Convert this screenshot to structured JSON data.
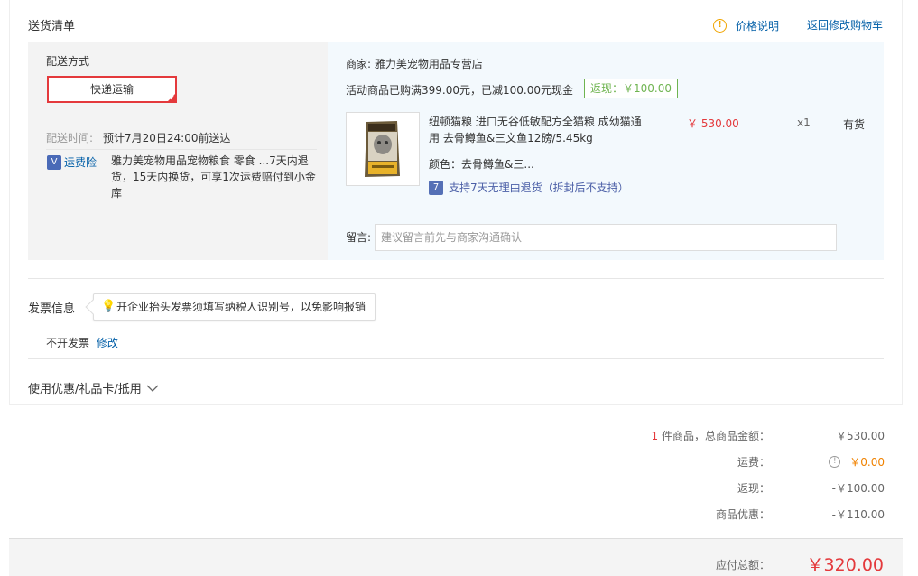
{
  "header": {
    "title": "送货清单",
    "price_note": "价格说明",
    "back_to_cart": "返回修改购物车"
  },
  "shipping": {
    "label": "配送方式",
    "method": "快递运输",
    "time_label": "配送时间:",
    "time_value": "预计7月20日24:00前送达",
    "insurance_badge": "V",
    "insurance_label": "运费险",
    "insurance_desc_1": "雅力美宠物用品宠物粮食 零食 ...7天内退",
    "insurance_desc_2": "货，15天内换货，可享1次运费赔付到小金",
    "insurance_desc_3": "库"
  },
  "shop": {
    "seller_label": "商家:",
    "seller_name": "雅力美宠物用品专营店",
    "promo_text": "活动商品已购满399.00元，已减100.00元现金",
    "cashback": "返现：￥100.00"
  },
  "item": {
    "name_line1": "纽顿猫粮 进口无谷低敏配方全猫粮 成幼猫通",
    "name_line2": "用 去骨鳟鱼&三文鱼12磅/5.45kg",
    "price": "￥ 530.00",
    "qty": "x1",
    "stock": "有货",
    "color_label": "颜色：",
    "color_value": "去骨鳟鱼&三...",
    "return_badge": "7",
    "return_policy": "支持7天无理由退货（拆封后不支持）"
  },
  "message": {
    "label": "留言:",
    "placeholder": "建议留言前先与商家沟通确认"
  },
  "invoice": {
    "title": "发票信息",
    "tip": "开企业抬头发票须填写纳税人识别号，以免影响报销",
    "status": "不开发票",
    "modify": "修改"
  },
  "coupon": {
    "label": "使用优惠/礼品卡/抵用"
  },
  "summary": {
    "count": "1",
    "count_suffix": "件商品，总商品金额：",
    "goods_amount": "￥530.00",
    "freight_label": "运费：",
    "freight_value": "￥0.00",
    "cashback_label": "返现：",
    "cashback_value": "-￥100.00",
    "discount_label": "商品优惠：",
    "discount_value": "-￥110.00",
    "total_label": "应付总额：",
    "total_value": "￥320.00"
  },
  "colors": {
    "accent_red": "#e4393c",
    "link_blue": "#005ea7",
    "cashback_green": "#6fb451",
    "freight_orange": "#f08200"
  }
}
